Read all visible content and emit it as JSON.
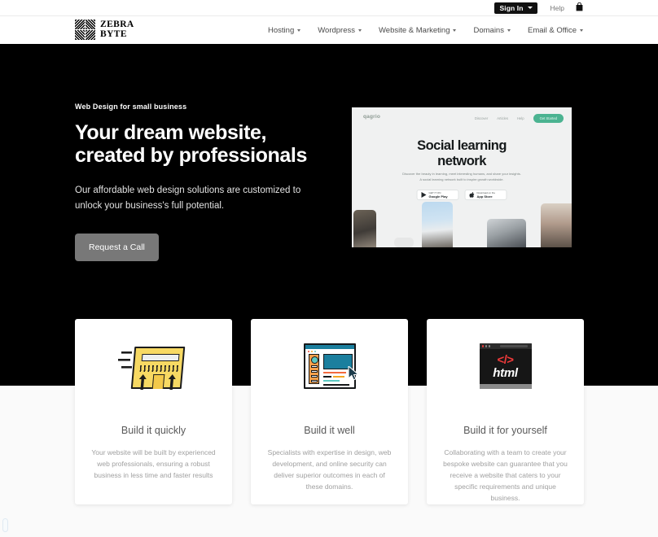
{
  "topbar": {
    "signin_label": "Sign In",
    "help_label": "Help",
    "cart_icon": "shopping-bag-icon"
  },
  "brand": {
    "line1": "ZEBRA",
    "line2": "BYTE",
    "logo_icon": "zebra-byte-logo-icon"
  },
  "nav": {
    "items": [
      {
        "label": "Hosting"
      },
      {
        "label": "Wordpress"
      },
      {
        "label": "Website & Marketing"
      },
      {
        "label": "Domains"
      },
      {
        "label": "Email & Office"
      }
    ]
  },
  "hero": {
    "eyebrow": "Web Design for small business",
    "title_line1": "Your dream website,",
    "title_line2": "created by professionals",
    "subtitle": "Our affordable web design solutions are customized to unlock your business's full potential.",
    "cta_label": "Request a Call",
    "background_color": "#000000",
    "cta_color": "#787878"
  },
  "mockup": {
    "logo": "qagrio",
    "nav_links": [
      "Discover",
      "Articles",
      "Help"
    ],
    "cta": "Get Started",
    "cta_color": "#4bb391",
    "title_line1": "Social learning",
    "title_line2": "network",
    "description": "Discover the beauty in learning, meet interesting humans, and share your insights. A social learning network built to inspire growth worldwide.",
    "store_google_small": "GET IT ON",
    "store_google_big": "Google Play",
    "store_apple_small": "Download on the",
    "store_apple_big": "App Store"
  },
  "cards": [
    {
      "icon": "fast-webpage-icon",
      "title": "Build it quickly",
      "body": "Your website will be built by experienced web professionals, ensuring a robust business in less time and faster results"
    },
    {
      "icon": "browser-design-icon",
      "title": "Build it well",
      "body": "Specialists with expertise in design, web development, and online security can deliver superior outcomes in each of these domains."
    },
    {
      "icon": "html-code-window-icon",
      "title": "Build it for yourself",
      "body": "Collaborating with a team to create your bespoke website can guarantee that you receive a website that caters to your specific requirements and unique business."
    }
  ]
}
